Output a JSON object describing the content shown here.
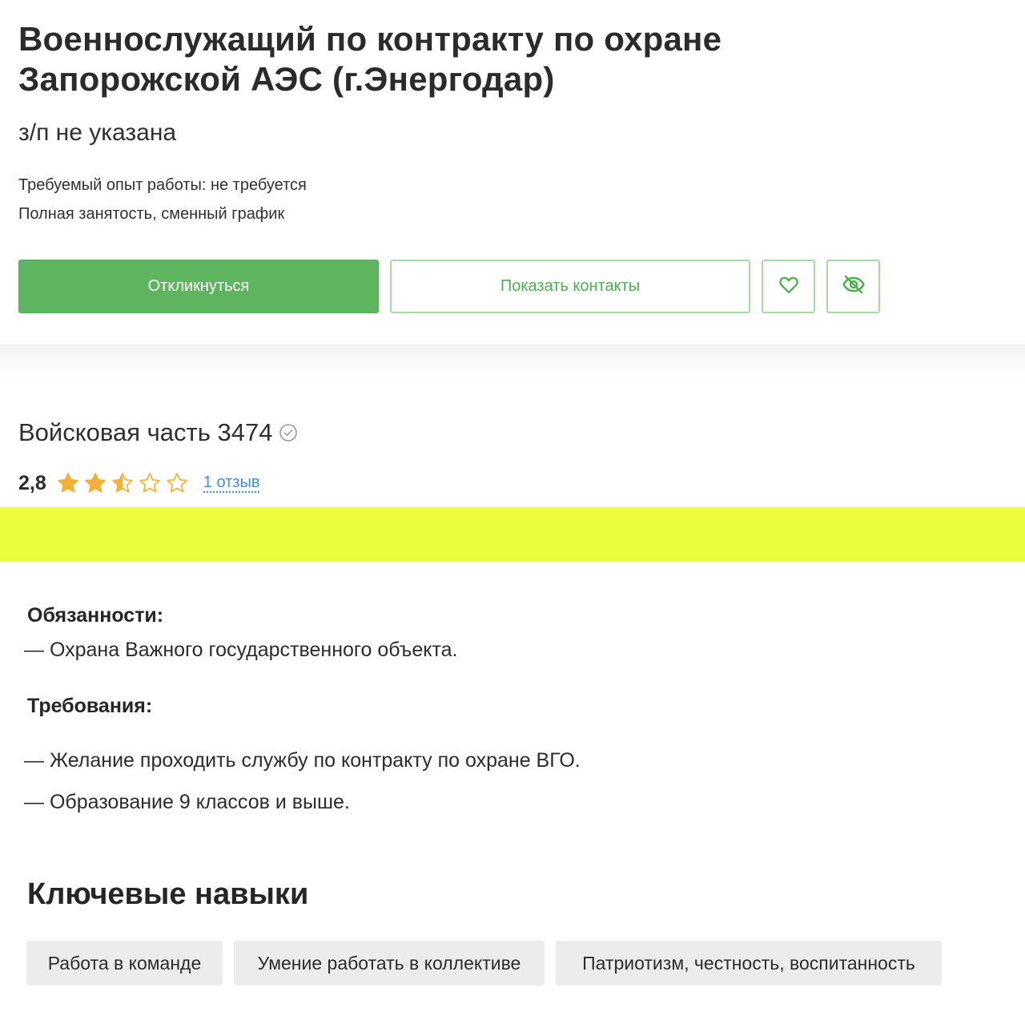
{
  "vacancy": {
    "title": "Военнослужащий по контракту по охране Запорожской АЭС (г.Энергодар)",
    "salary": "з/п не указана",
    "experience": "Требуемый опыт работы: не требуется",
    "employment": "Полная занятость, сменный график"
  },
  "actions": {
    "respond_label": "Откликнуться",
    "contacts_label": "Показать контакты",
    "favorite_icon": "heart-icon",
    "hide_icon": "eye-off-icon"
  },
  "company": {
    "name": "Войсковая часть 3474",
    "verified_icon": "check-circle-icon",
    "rating": "2,8",
    "rating_value": 2.5,
    "stars_total": 5,
    "reviews_link": "1 отзыв"
  },
  "description": {
    "duties_heading": "Обязанности:",
    "duties": [
      "— Охрана Важного государственного объекта."
    ],
    "requirements_heading": "Требования:",
    "requirements": [
      "— Желание проходить службу по контракту по охране ВГО.",
      "— Образование 9 классов и выше."
    ]
  },
  "skills": {
    "heading": "Ключевые навыки",
    "items": [
      "Работа в команде",
      "Умение работать в коллективе",
      "Патриотизм, честность, воспитанность"
    ]
  },
  "colors": {
    "primary_green": "#5fb45f",
    "outline_green": "#a9d8a9",
    "star_gold": "#f2b134",
    "link_blue": "#3c8fd9",
    "highlight_yellow": "#eaff3a",
    "tag_gray": "#ececec"
  }
}
